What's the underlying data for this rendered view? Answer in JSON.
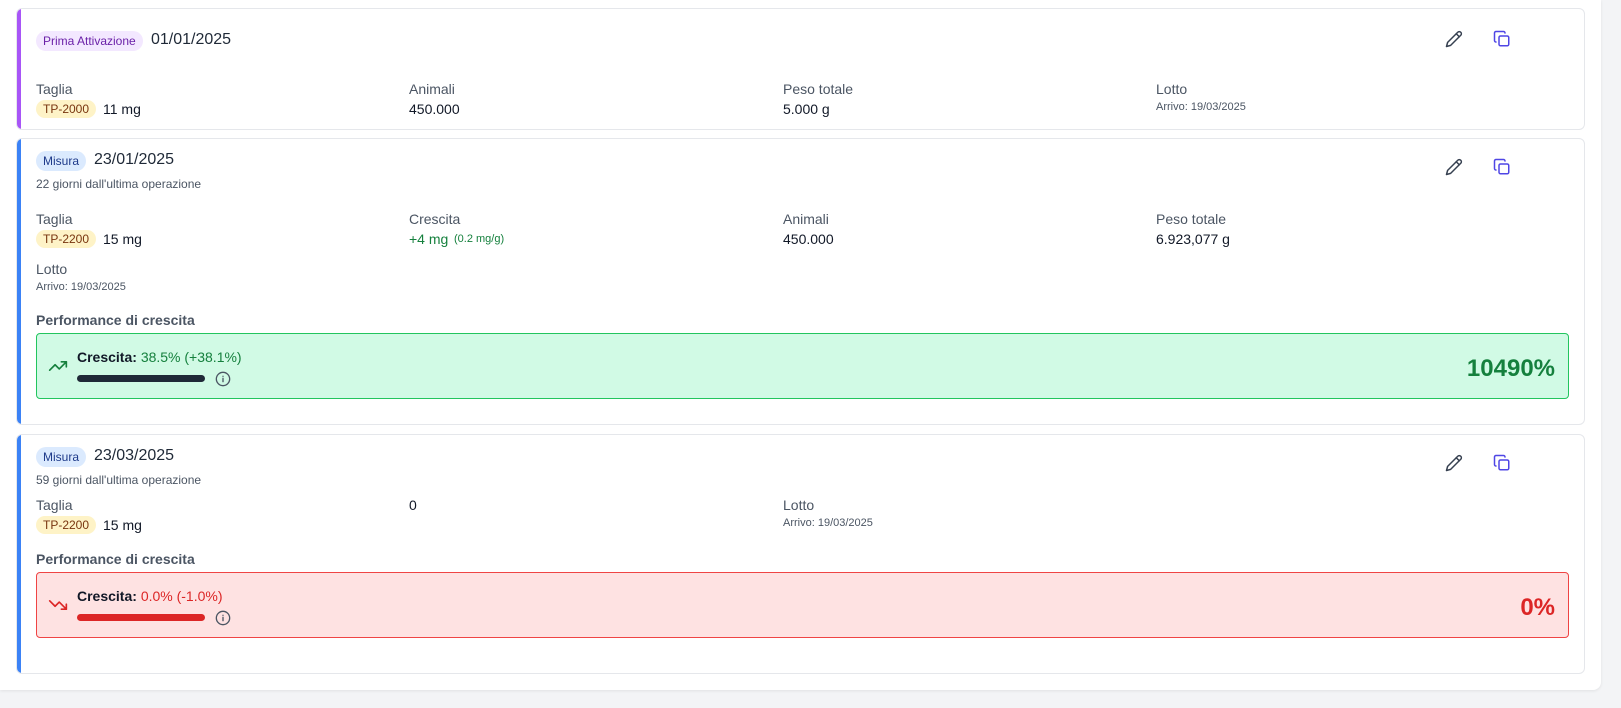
{
  "operations": [
    {
      "badge": "Prima Attivazione",
      "date": "01/01/2025",
      "fields": {
        "taglia_label": "Taglia",
        "taglia_tag": "TP-2000",
        "taglia_value": "11 mg",
        "animali_label": "Animali",
        "animali_value": "450.000",
        "peso_label": "Peso totale",
        "peso_value": "5.000 g",
        "lotto_label": "Lotto",
        "lotto_value": "Arrivo: 19/03/2025"
      }
    },
    {
      "badge": "Misura",
      "date": "23/01/2025",
      "subtitle": "22 giorni dall'ultima operazione",
      "fields": {
        "taglia_label": "Taglia",
        "taglia_tag": "TP-2200",
        "taglia_value": "15 mg",
        "crescita_label": "Crescita",
        "crescita_value": "+4 mg",
        "crescita_rate": "(0.2 mg/g)",
        "animali_label": "Animali",
        "animali_value": "450.000",
        "peso_label": "Peso totale",
        "peso_value": "6.923,077 g",
        "lotto_label": "Lotto",
        "lotto_value": "Arrivo: 19/03/2025"
      },
      "performance": {
        "title": "Performance di crescita",
        "label": "Crescita:",
        "value": "38.5% (+38.1%)",
        "percent": "10490%",
        "status": "positive",
        "color": "#15803d",
        "bar_color": "#1f2937",
        "fill": 1.0
      }
    },
    {
      "badge": "Misura",
      "date": "23/03/2025",
      "subtitle": "59 giorni dall'ultima operazione",
      "fields": {
        "taglia_label": "Taglia",
        "taglia_tag": "TP-2200",
        "taglia_value": "15 mg",
        "count_value": "0",
        "lotto_label": "Lotto",
        "lotto_value": "Arrivo: 19/03/2025"
      },
      "performance": {
        "title": "Performance di crescita",
        "label": "Crescita:",
        "value": "0.0% (-1.0%)",
        "percent": "0%",
        "status": "negative",
        "color": "#dc2626",
        "bar_color": "#dc2626",
        "fill": 1.0
      }
    }
  ],
  "icons": {
    "edit": "pencil-icon",
    "duplicate": "copy-icon",
    "trend_up": "trending-up-icon",
    "trend_down": "trending-down-icon",
    "info": "info-icon"
  }
}
